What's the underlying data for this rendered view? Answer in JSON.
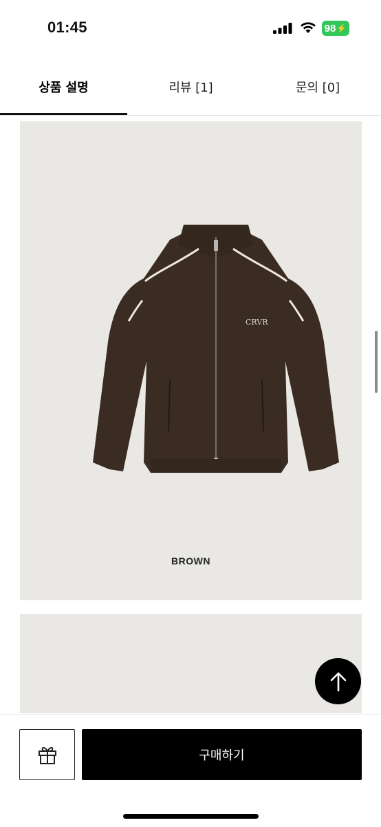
{
  "status_bar": {
    "time": "01:45",
    "battery": "98",
    "icons": [
      "cellular-signal-icon",
      "wifi-icon",
      "battery-charging-icon"
    ]
  },
  "tabs": [
    {
      "label": "상품 설명",
      "active": true
    },
    {
      "label": "리뷰 [1]",
      "active": false
    },
    {
      "label": "문의 [0]",
      "active": false
    }
  ],
  "product": {
    "image_logo_text": "CRVR",
    "color_label": "BROWN",
    "jacket_color": "#3a2c22",
    "piping_color": "#efe9df",
    "background_color": "#e9e8e4"
  },
  "actions": {
    "scroll_top_icon": "arrow-up-icon",
    "gift_icon": "gift-icon",
    "buy_label": "구매하기"
  }
}
